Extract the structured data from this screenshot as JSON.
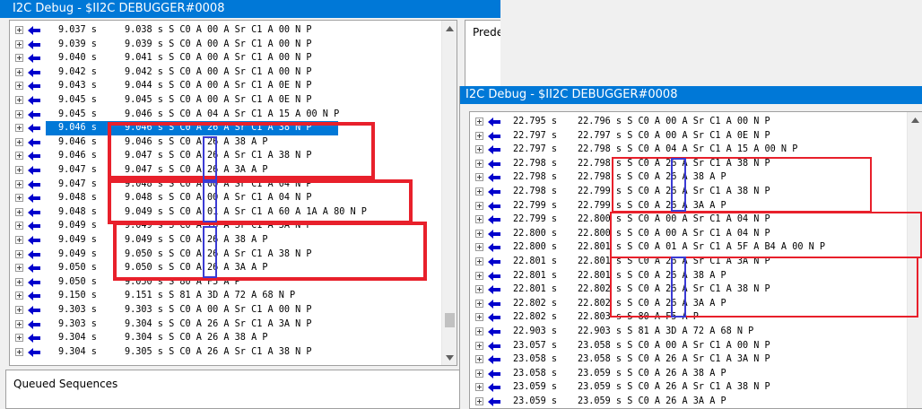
{
  "left_window": {
    "title": "I2C Debug - $II2C DEBUGGER#0008",
    "predef_label": "Prede",
    "queued_label": "Queued Sequences",
    "rows": [
      {
        "time": "9.037 s",
        "cmd": "9.038 s S C0 A 00 A Sr C1 A 00 N P"
      },
      {
        "time": "9.039 s",
        "cmd": "9.039 s S C0 A 00 A Sr C1 A 00 N P"
      },
      {
        "time": "9.040 s",
        "cmd": "9.041 s S C0 A 00 A Sr C1 A 00 N P"
      },
      {
        "time": "9.042 s",
        "cmd": "9.042 s S C0 A 00 A Sr C1 A 00 N P"
      },
      {
        "time": "9.043 s",
        "cmd": "9.044 s S C0 A 00 A Sr C1 A 0E N P"
      },
      {
        "time": "9.045 s",
        "cmd": "9.045 s S C0 A 00 A Sr C1 A 0E N P"
      },
      {
        "time": "9.045 s",
        "cmd": "9.046 s S C0 A 04 A Sr C1 A 15 A 00 N P"
      },
      {
        "time": "9.046 s",
        "cmd": "9.046 s S C0 A 26 A Sr C1 A 38 N P"
      },
      {
        "time": "9.046 s",
        "cmd": "9.046 s S C0 A 26 A 38 A P"
      },
      {
        "time": "9.046 s",
        "cmd": "9.047 s S C0 A 26 A Sr C1 A 38 N P"
      },
      {
        "time": "9.047 s",
        "cmd": "9.047 s S C0 A 26 A 3A A P"
      },
      {
        "time": "9.047 s",
        "cmd": "9.048 s S C0 A 00 A Sr C1 A 04 N P"
      },
      {
        "time": "9.048 s",
        "cmd": "9.048 s S C0 A 00 A Sr C1 A 04 N P"
      },
      {
        "time": "9.048 s",
        "cmd": "9.049 s S C0 A 01 A Sr C1 A 60 A 1A A 80 N P"
      },
      {
        "time": "9.049 s",
        "cmd": "9.049 s S C0 A 26 A Sr C1 A 3A N P"
      },
      {
        "time": "9.049 s",
        "cmd": "9.049 s S C0 A 26 A 38 A P"
      },
      {
        "time": "9.049 s",
        "cmd": "9.050 s S C0 A 26 A Sr C1 A 38 N P"
      },
      {
        "time": "9.050 s",
        "cmd": "9.050 s S C0 A 26 A 3A A P"
      },
      {
        "time": "9.050 s",
        "cmd": "9.050 s S 80 A F5 A P"
      },
      {
        "time": "9.150 s",
        "cmd": "9.151 s S 81 A 3D A 72 A 68 N P"
      },
      {
        "time": "9.303 s",
        "cmd": "9.303 s S C0 A 00 A Sr C1 A 00 N P"
      },
      {
        "time": "9.303 s",
        "cmd": "9.304 s S C0 A 26 A Sr C1 A 3A N P"
      },
      {
        "time": "9.304 s",
        "cmd": "9.304 s S C0 A 26 A 38 A P"
      },
      {
        "time": "9.304 s",
        "cmd": "9.305 s S C0 A 26 A Sr C1 A 38 N P"
      }
    ]
  },
  "right_window": {
    "title": "I2C Debug - $II2C DEBUGGER#0008",
    "rows": [
      {
        "time": "22.795 s",
        "cmd": "22.796 s S C0 A 00 A Sr C1 A 00 N P"
      },
      {
        "time": "22.797 s",
        "cmd": "22.797 s S C0 A 00 A Sr C1 A 0E N P"
      },
      {
        "time": "22.797 s",
        "cmd": "22.798 s S C0 A 04 A Sr C1 A 15 A 00 N P"
      },
      {
        "time": "22.798 s",
        "cmd": "22.798 s S C0 A 26 A Sr C1 A 38 N P"
      },
      {
        "time": "22.798 s",
        "cmd": "22.798 s S C0 A 26 A 38 A P"
      },
      {
        "time": "22.798 s",
        "cmd": "22.799 s S C0 A 26 A Sr C1 A 38 N P"
      },
      {
        "time": "22.799 s",
        "cmd": "22.799 s S C0 A 26 A 3A A P"
      },
      {
        "time": "22.799 s",
        "cmd": "22.800 s S C0 A 00 A Sr C1 A 04 N P"
      },
      {
        "time": "22.800 s",
        "cmd": "22.800 s S C0 A 00 A Sr C1 A 04 N P"
      },
      {
        "time": "22.800 s",
        "cmd": "22.801 s S C0 A 01 A Sr C1 A 5F A B4 A 00 N P"
      },
      {
        "time": "22.801 s",
        "cmd": "22.801 s S C0 A 26 A Sr C1 A 3A N P"
      },
      {
        "time": "22.801 s",
        "cmd": "22.801 s S C0 A 26 A 38 A P"
      },
      {
        "time": "22.801 s",
        "cmd": "22.802 s S C0 A 26 A Sr C1 A 38 N P"
      },
      {
        "time": "22.802 s",
        "cmd": "22.802 s S C0 A 26 A 3A A P"
      },
      {
        "time": "22.802 s",
        "cmd": "22.803 s S 80 A F5 A P"
      },
      {
        "time": "22.903 s",
        "cmd": "22.903 s S 81 A 3D A 72 A 68 N P"
      },
      {
        "time": "23.057 s",
        "cmd": "23.058 s S C0 A 00 A Sr C1 A 00 N P"
      },
      {
        "time": "23.058 s",
        "cmd": "23.058 s S C0 A 26 A Sr C1 A 3A N P"
      },
      {
        "time": "23.058 s",
        "cmd": "23.059 s S C0 A 26 A 38 A P"
      },
      {
        "time": "23.059 s",
        "cmd": "23.059 s S C0 A 26 A Sr C1 A 38 N P"
      },
      {
        "time": "23.059 s",
        "cmd": "23.059 s S C0 A 26 A 3A A P"
      }
    ]
  },
  "colors": {
    "titlebar": "#0078d7",
    "selection": "#0078d7",
    "arrow": "#0000cc",
    "annotation_red": "#e8202b",
    "annotation_blue": "#3b3bd4"
  }
}
